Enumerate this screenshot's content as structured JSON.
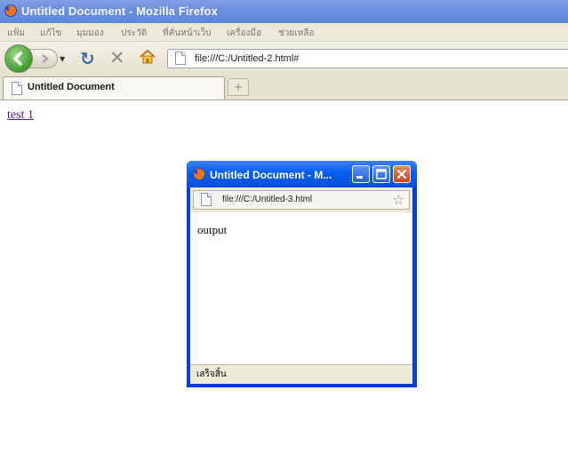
{
  "window": {
    "title": "Untitled Document - Mozilla Firefox"
  },
  "menu": {
    "items": [
      "แฟ้ม",
      "แก้ไข",
      "มุมมอง",
      "ประวัติ",
      "ที่คั่นหน้าเว็บ",
      "เครื่องมือ",
      "ช่วยเหลือ"
    ]
  },
  "nav": {
    "url": "file:///C:/Untitled-2.html#"
  },
  "tabs": {
    "active_label": "Untitled Document",
    "new_tab_symbol": "+"
  },
  "content": {
    "link_text": "test 1"
  },
  "popup": {
    "title": "Untitled Document - M...",
    "url": "file:///C:/Untitled-3.html",
    "body_text": "output",
    "status": "เสร็จสิ้น"
  },
  "colors": {
    "xp_blue": "#0a4fd8",
    "link_visited": "#551a8b",
    "chrome_beige": "#ece9d8"
  },
  "icons": [
    "firefox-icon",
    "back-arrow-icon",
    "forward-arrow-icon",
    "reload-icon",
    "stop-icon",
    "home-icon",
    "page-icon",
    "bookmark-star-icon",
    "minimize-icon",
    "maximize-icon",
    "close-icon"
  ]
}
